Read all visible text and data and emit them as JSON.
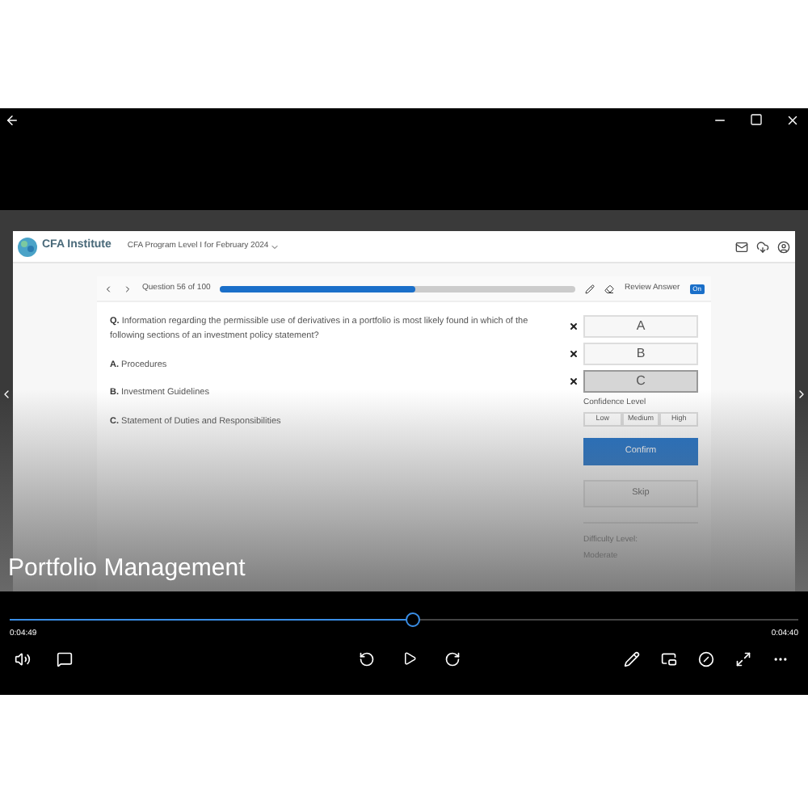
{
  "app": {
    "brand": "CFA Institute",
    "program": "CFA Program Level I for February 2024",
    "question_counter": "Question 56 of 100",
    "progress": {
      "level": 0.55
    },
    "review_answer": {
      "label": "Review Answer",
      "toggle": "On",
      "on": true
    },
    "question": {
      "prefix": "Q.",
      "text": "Information regarding the permissible use of derivatives in a portfolio is most likely found in which of the following sections of an investment policy statement?"
    },
    "options": [
      {
        "letter": "A.",
        "text": "Procedures"
      },
      {
        "letter": "B.",
        "text": "Investment Guidelines"
      },
      {
        "letter": "C.",
        "text": "Statement of Duties and Responsibilities"
      }
    ],
    "answers": [
      {
        "label": "A",
        "selected": false
      },
      {
        "label": "B",
        "selected": false
      },
      {
        "label": "C",
        "selected": true
      }
    ],
    "confidence": {
      "label": "Confidence Level",
      "options": [
        {
          "label": "Low",
          "selected": false
        },
        {
          "label": "Medium",
          "selected": false
        },
        {
          "label": "High",
          "selected": false
        }
      ]
    },
    "confirm": "Confirm",
    "skip": "Skip",
    "difficulty": {
      "label": "Difficulty Level:",
      "value": "Moderate"
    }
  },
  "player": {
    "title": "Portfolio Management",
    "seek": {
      "level": 0.51
    },
    "elapsed": "0:04:49",
    "remaining": "0:04:40"
  }
}
